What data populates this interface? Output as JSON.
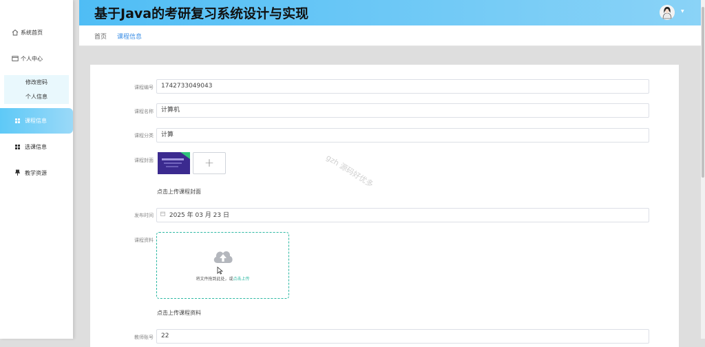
{
  "header": {
    "title": "基于Java的考研复习系统设计与实现"
  },
  "sidebar": {
    "home": "系统首页",
    "personal_center": "个人中心",
    "sub_items": [
      "修改密码",
      "个人信息"
    ],
    "course_info": "课程信息",
    "course_selection": "选课信息",
    "teaching_resources": "教学资源"
  },
  "breadcrumb": {
    "home": "首页",
    "current": "课程信息"
  },
  "form": {
    "course_no_label": "课程编号",
    "course_no": "1742733049043",
    "course_name_label": "课程名称",
    "course_name": "计算机",
    "category_label": "课程分类",
    "category": "计算",
    "cover_label": "课程封面",
    "cover_hint": "点击上传课程封面",
    "publish_time_label": "发布时间",
    "publish_time": "2025 年 03 月 23 日",
    "material_label": "课程资料",
    "drop_text": "将文件拖到此处，或",
    "drop_link": "点击上传",
    "material_hint": "点击上传课程资料",
    "teacher_no_label": "教师账号",
    "teacher_no": "22"
  },
  "watermark": "gzh 源码好优多",
  "colors": {
    "header_start": "#4fbdf5",
    "header_end": "#8ad3f7",
    "accent": "#2bb8a2",
    "active_link": "#3a8ee6"
  }
}
